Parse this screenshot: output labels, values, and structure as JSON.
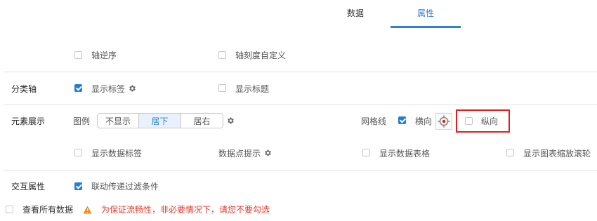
{
  "tabs": [
    {
      "label": "数据",
      "active": false
    },
    {
      "label": "属性",
      "active": true
    }
  ],
  "accent_color": "#2f80d1",
  "warning_color": "#e33a2e",
  "top_options": {
    "reverse_axis": {
      "label": "轴逆序",
      "checked": false
    },
    "custom_axis_scale": {
      "label": "轴刻度自定义",
      "checked": false
    }
  },
  "category_axis": {
    "section_label": "分类轴",
    "show_labels": {
      "label": "显示标签",
      "checked": true,
      "icon": "gear-icon"
    },
    "show_title": {
      "label": "显示标题",
      "checked": false
    }
  },
  "element_display": {
    "section_label": "元素展示",
    "legend": {
      "label": "图例",
      "options": [
        "不显示",
        "居下",
        "居右"
      ],
      "selected": "居下",
      "icon": "gear-icon"
    },
    "gridlines": {
      "label": "网格线",
      "horizontal": {
        "label": "横向",
        "checked": true,
        "icon": "target-icon"
      },
      "vertical": {
        "label": "纵向",
        "checked": false
      }
    },
    "show_data_labels": {
      "label": "显示数据标签",
      "checked": false
    },
    "data_point_tips": {
      "label": "数据点提示",
      "icon": "gear-icon"
    },
    "show_data_table": {
      "label": "显示数据表格",
      "checked": false
    },
    "show_zoom_slider": {
      "label": "显示图表缩放滚轮",
      "checked": false
    }
  },
  "interaction": {
    "section_label": "交互属性",
    "linked_filter": {
      "label": "联动传递过滤条件",
      "checked": true
    }
  },
  "view_all_data": {
    "label": "查看所有数据",
    "checked": false,
    "warning_icon": "warning-icon",
    "warning": "为保证流畅性，非必要情况下，请您不要勾选"
  }
}
